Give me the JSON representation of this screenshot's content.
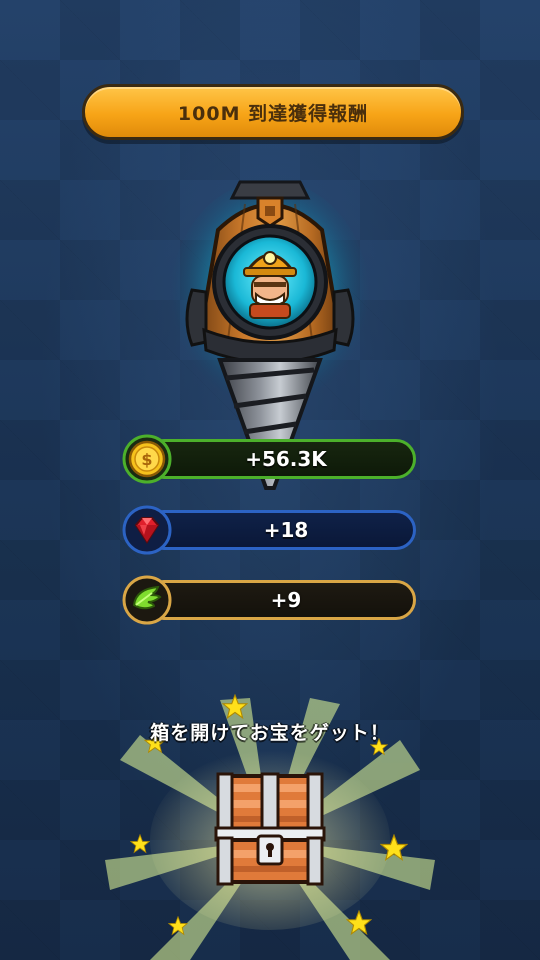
{
  "title_banner": {
    "text": "100M 到達獲得報酬"
  },
  "drill": {
    "icon": "drill-machine-with-miner"
  },
  "rewards": [
    {
      "icon": "coin-icon",
      "value": "+56.3K",
      "accent": "#4cb02b"
    },
    {
      "icon": "ruby-gem-icon",
      "value": "+18",
      "accent": "#2c63c4"
    },
    {
      "icon": "green-wing-icon",
      "value": "+9",
      "accent": "#d9a646"
    }
  ],
  "prompt": {
    "text": "箱を開けてお宝をゲット！"
  },
  "chest": {
    "icon": "treasure-chest-icon"
  },
  "colors": {
    "background": "#1f3a5e",
    "banner": "#f7a417",
    "star": "#ffe01a"
  }
}
